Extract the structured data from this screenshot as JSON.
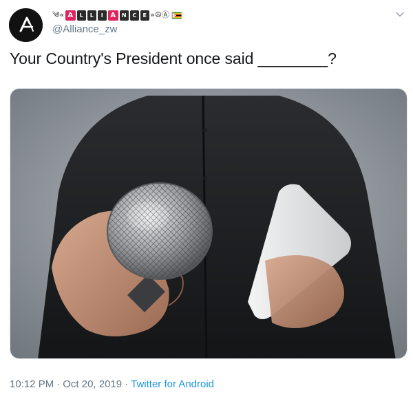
{
  "header": {
    "avatar_icon": "alliance-logo-icon",
    "display_name": {
      "prefix": "༄«",
      "block1": [
        "A",
        "L",
        "L",
        "I"
      ],
      "block2": [
        "A",
        "N",
        "C",
        "E"
      ],
      "suffix": "»☮Ⓐ",
      "flag_icon": "zimbabwe-flag-icon"
    },
    "handle": "@Alliance_zw",
    "menu_icon": "chevron-down-icon"
  },
  "tweet": {
    "text": "Your Country's President once said ________?"
  },
  "media": {
    "description_icon": "microphone-photo"
  },
  "footer": {
    "time": "10:12 PM",
    "separator1": "·",
    "date": "Oct 20, 2019",
    "separator2": "·",
    "source": "Twitter for Android"
  },
  "colors": {
    "text": "#14171a",
    "muted": "#657786",
    "link": "#1b95e0",
    "accent_red": "#e0245e"
  }
}
